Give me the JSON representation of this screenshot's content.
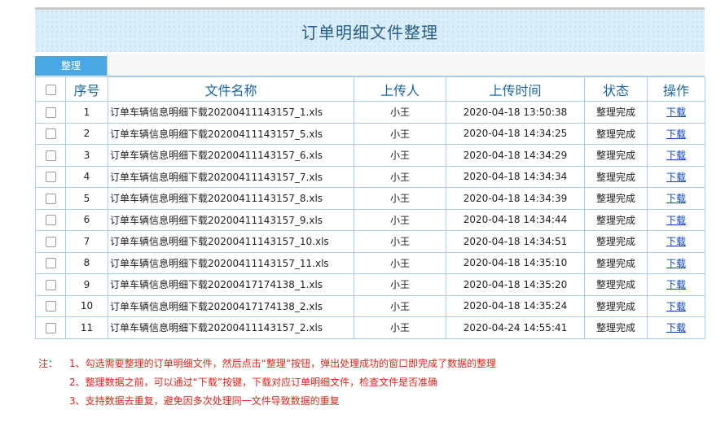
{
  "page": {
    "title": "订单明细文件整理",
    "action_button": "整理"
  },
  "table": {
    "headers": [
      "序号",
      "文件名称",
      "上传人",
      "上传时间",
      "状态",
      "操作"
    ],
    "rows": [
      {
        "no": "1",
        "file": "订单车辆信息明细下载20200411143157_1.xls",
        "uploader": "小王",
        "time": "2020-04-18 13:50:38",
        "status": "整理完成",
        "op": "下载"
      },
      {
        "no": "2",
        "file": "订单车辆信息明细下载20200411143157_5.xls",
        "uploader": "小王",
        "time": "2020-04-18 14:34:25",
        "status": "整理完成",
        "op": "下载"
      },
      {
        "no": "3",
        "file": "订单车辆信息明细下载20200411143157_6.xls",
        "uploader": "小王",
        "time": "2020-04-18 14:34:29",
        "status": "整理完成",
        "op": "下载"
      },
      {
        "no": "4",
        "file": "订单车辆信息明细下载20200411143157_7.xls",
        "uploader": "小王",
        "time": "2020-04-18 14:34:34",
        "status": "整理完成",
        "op": "下载"
      },
      {
        "no": "5",
        "file": "订单车辆信息明细下载20200411143157_8.xls",
        "uploader": "小王",
        "time": "2020-04-18 14:34:39",
        "status": "整理完成",
        "op": "下载"
      },
      {
        "no": "6",
        "file": "订单车辆信息明细下载20200411143157_9.xls",
        "uploader": "小王",
        "time": "2020-04-18 14:34:44",
        "status": "整理完成",
        "op": "下载"
      },
      {
        "no": "7",
        "file": "订单车辆信息明细下载20200411143157_10.xls",
        "uploader": "小王",
        "time": "2020-04-18 14:34:51",
        "status": "整理完成",
        "op": "下载"
      },
      {
        "no": "8",
        "file": "订单车辆信息明细下载20200411143157_11.xls",
        "uploader": "小王",
        "time": "2020-04-18 14:35:10",
        "status": "整理完成",
        "op": "下载"
      },
      {
        "no": "9",
        "file": "订单车辆信息明细下载20200417174138_1.xls",
        "uploader": "小王",
        "time": "2020-04-18 14:35:20",
        "status": "整理完成",
        "op": "下载"
      },
      {
        "no": "10",
        "file": "订单车辆信息明细下载20200417174138_2.xls",
        "uploader": "小王",
        "time": "2020-04-18 14:35:24",
        "status": "整理完成",
        "op": "下载"
      },
      {
        "no": "11",
        "file": "订单车辆信息明细下载20200411143157_2.xls",
        "uploader": "小王",
        "time": "2020-04-24 14:55:41",
        "status": "整理完成",
        "op": "下载"
      }
    ]
  },
  "notes": {
    "label": "注：",
    "items": [
      "1、勾选需要整理的订单明细文件，然后点击“整理”按钮，弹出处理成功的窗口即完成了数据的整理",
      "2、整理数据之前，可以通过“下载”按键，下载对应订单明细文件，检查文件是否准确",
      "3、支持数据去重复，避免因多次处理同一文件导致数据的重复"
    ]
  },
  "colors": {
    "title_bg": "#d9eef9",
    "button_bg": "#4aa8e4",
    "header_text": "#1b64a8",
    "link": "#0a3fbf",
    "notes_text": "#e2231a"
  }
}
